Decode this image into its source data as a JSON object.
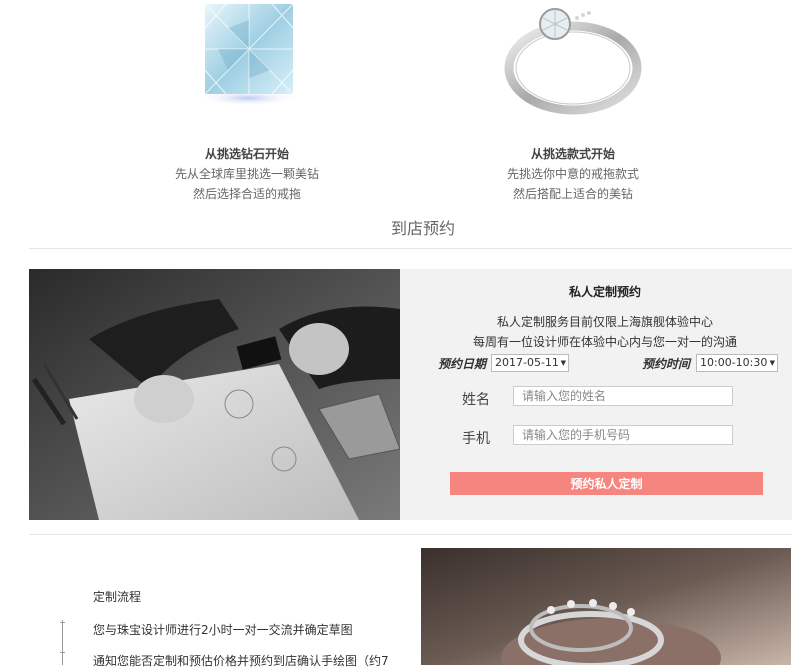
{
  "cards": [
    {
      "image": "diamond-image",
      "title": "从挑选钻石开始",
      "lines": [
        "先从全球库里挑选一颗美钻",
        "然后选择合适的戒拖"
      ]
    },
    {
      "image": "ring-image",
      "title": "从挑选款式开始",
      "lines": [
        "先挑选你中意的戒拖款式",
        "然后搭配上适合的美钻"
      ]
    }
  ],
  "section_heading": "到店预约",
  "booking": {
    "title": "私人定制预约",
    "line1": "私人定制服务目前仅限上海旗舰体验中心",
    "line2": "每周有一位设计师在体验中心内与您一对一的沟通",
    "date_label": "预约日期",
    "date_value": "2017-05-11",
    "time_label": "预约时间",
    "time_value": "10:00-10:30",
    "name_label": "姓名",
    "name_placeholder": "请输入您的姓名",
    "phone_label": "手机",
    "phone_placeholder": "请输入您的手机号码",
    "submit_label": "预约私人定制"
  },
  "process": {
    "title": "定制流程",
    "steps": [
      "您与珠宝设计师进行2小时一对一交流并确定草图",
      "通知您能否定制和预估价格并预约到店确认手绘图（约7"
    ]
  },
  "colors": {
    "accent": "#f5857e",
    "panel_bg": "#f2f2f2"
  }
}
